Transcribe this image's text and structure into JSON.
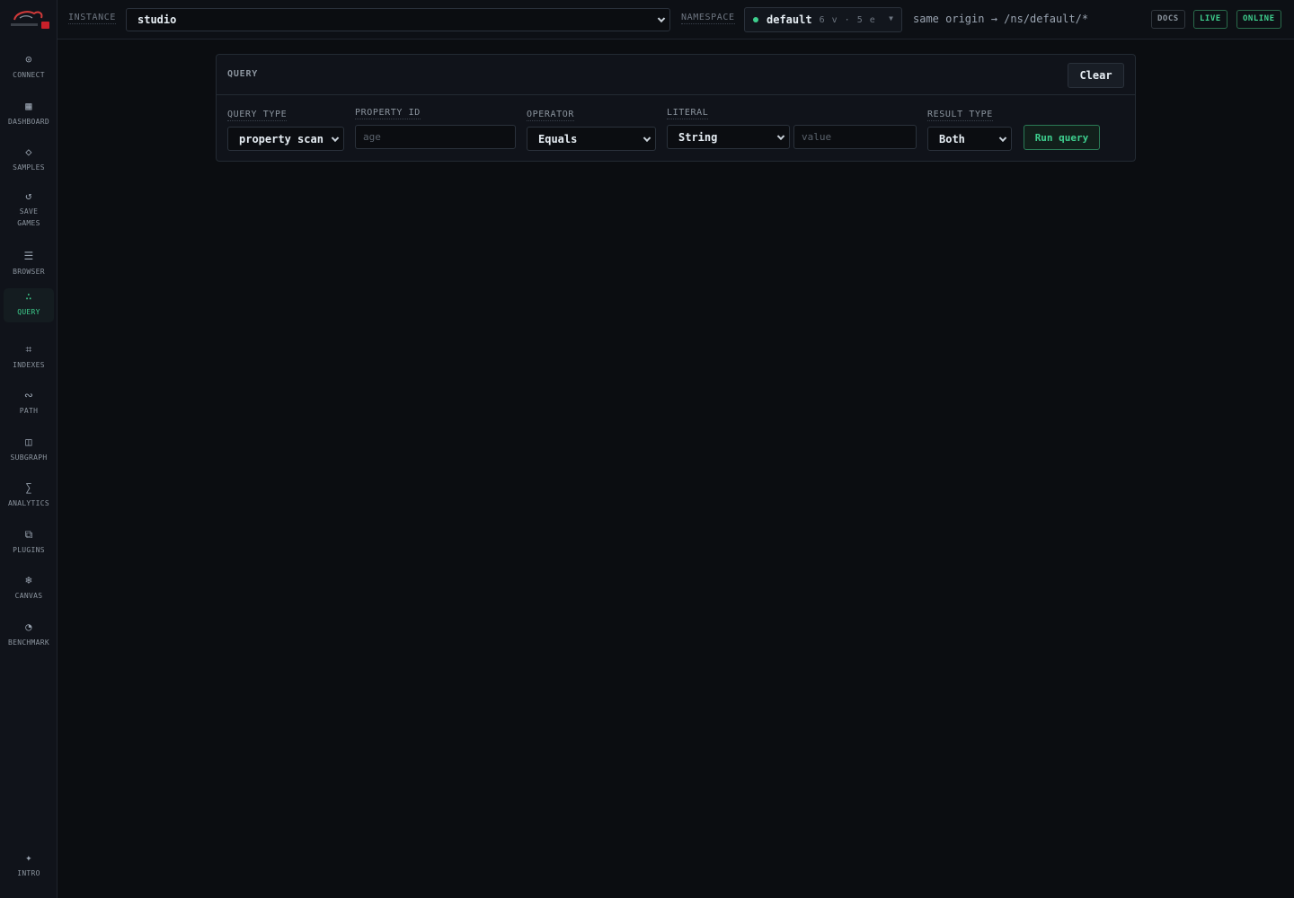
{
  "sidebar": {
    "items": [
      {
        "label": "CONNECT",
        "icon": "⊙",
        "icon_name": "connect-icon"
      },
      {
        "label": "DASHBOARD",
        "icon": "▦",
        "icon_name": "dashboard-icon"
      },
      {
        "label": "SAMPLES",
        "icon": "◇",
        "icon_name": "samples-icon"
      },
      {
        "label": "SAVE GAMES",
        "icon": "↺",
        "icon_name": "save-games-icon"
      },
      {
        "label": "BROWSER",
        "icon": "☰",
        "icon_name": "browser-icon"
      },
      {
        "label": "QUERY",
        "icon": "∴",
        "icon_name": "query-icon",
        "active": true
      },
      {
        "label": "INDEXES",
        "icon": "⌗",
        "icon_name": "indexes-icon"
      },
      {
        "label": "PATH",
        "icon": "∾",
        "icon_name": "path-icon"
      },
      {
        "label": "SUBGRAPH",
        "icon": "◫",
        "icon_name": "subgraph-icon"
      },
      {
        "label": "ANALYTICS",
        "icon": "∑",
        "icon_name": "analytics-icon"
      },
      {
        "label": "PLUGINS",
        "icon": "⧉",
        "icon_name": "plugins-icon"
      },
      {
        "label": "CANVAS",
        "icon": "❄",
        "icon_name": "canvas-icon"
      },
      {
        "label": "BENCHMARK",
        "icon": "◔",
        "icon_name": "benchmark-icon"
      }
    ],
    "footer": {
      "label": "INTRO",
      "icon": "✦",
      "icon_name": "intro-icon"
    }
  },
  "topbar": {
    "instance_label": "INSTANCE",
    "instance_value": "studio",
    "namespace_label": "NAMESPACE",
    "namespace_name": "default",
    "namespace_counts": "6 v · 5 e",
    "origin": "same origin → /ns/default/*",
    "badges": {
      "docs": "DOCS",
      "live": "LIVE",
      "online": "ONLINE"
    }
  },
  "query": {
    "title": "QUERY",
    "clear_label": "Clear",
    "query_type_label": "QUERY TYPE",
    "query_type_value": "property scan",
    "property_id_label": "PROPERTY ID",
    "property_id_placeholder": "age",
    "operator_label": "OPERATOR",
    "operator_value": "Equals",
    "literal_label": "LITERAL",
    "literal_type_value": "String",
    "literal_value_placeholder": "value",
    "result_type_label": "RESULT TYPE",
    "result_type_value": "Both",
    "run_label": "Run query"
  },
  "colors": {
    "accent": "#3ecf8e",
    "background": "#0b0d11",
    "panel": "#10131a"
  }
}
